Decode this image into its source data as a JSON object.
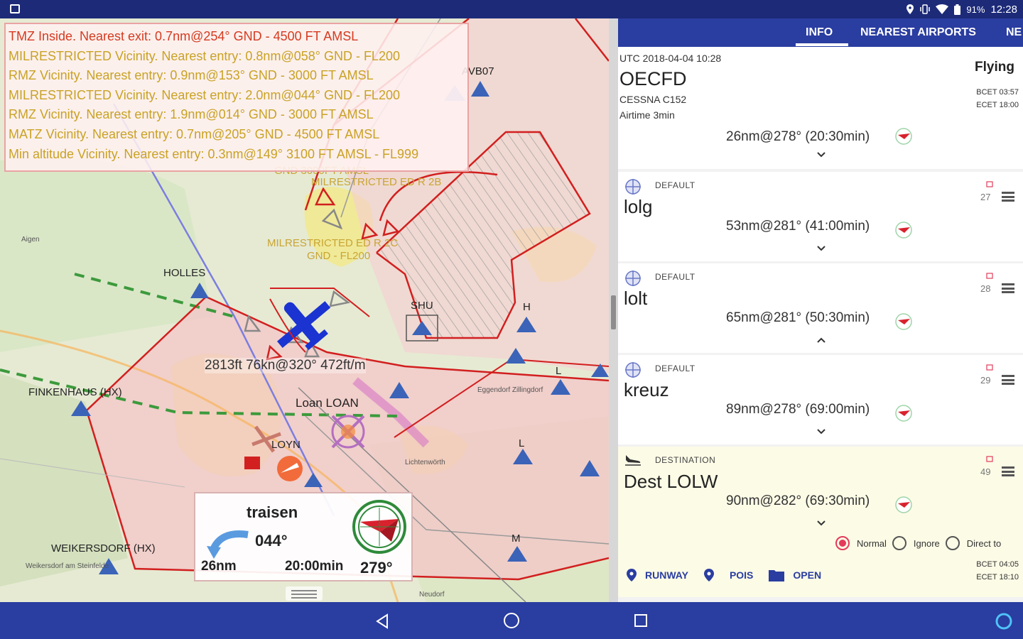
{
  "status_bar": {
    "battery": "91%",
    "time": "12:28"
  },
  "map": {
    "warnings": [
      "TMZ Inside. Nearest exit: 0.7nm@254° GND - 4500 FT AMSL",
      "MILRESTRICTED Vicinity. Nearest entry: 0.8nm@058° GND - FL200",
      "RMZ Vicinity. Nearest entry: 0.9nm@153° GND - 3000 FT AMSL",
      "MILRESTRICTED Vicinity. Nearest entry: 2.0nm@044° GND - FL200",
      "RMZ Vicinity. Nearest entry: 1.9nm@014° GND - 3000 FT AMSL",
      "MATZ Vicinity. Nearest entry: 0.7nm@205° GND - 4500 FT AMSL",
      "Min altitude Vicinity. Nearest entry: 0.3nm@149° 3100 FT AMSL - FL999"
    ],
    "labels": {
      "finkenhaus": "FINKENHAUS (HX)",
      "weikersdorf": "WEIKERSDORF (HX)",
      "weikersdorf_town": "Weikersdorf am Steinfelde",
      "holle": "HOLLES",
      "shu": "SHU",
      "avb07": "AVB07",
      "loan": "Loan LOAN",
      "loyn": "LOYN",
      "lichtenwörth": "Lichtenwörth",
      "zillingdorf": "Eggendorf Zillingdorf",
      "neudorf": "Neudorf",
      "aigen": "Aigen",
      "milrestricted": "MILRESTRICTED ED R 2C",
      "gnd": "GND - FL200",
      "gnd3000": "GND 3000FT AMSL",
      "milrestricted2": "MILRESTRICTED ED R 2B",
      "l1": "L",
      "l2": "L",
      "h": "H",
      "m": "M"
    },
    "aircraft_readout": "2813ft 76kn@320° 472ft/m",
    "nav_card": {
      "waypoint": "traisen",
      "heading": "044°",
      "distance": "26nm",
      "ete": "20:00min",
      "course": "279°"
    }
  },
  "tabs": [
    {
      "label": "INFO",
      "active": true
    },
    {
      "label": "NEAREST AIRPORTS",
      "active": false
    },
    {
      "label": "NE",
      "active": false
    }
  ],
  "info": {
    "utc": "UTC 2018-04-04 10:28",
    "registration": "OECFD",
    "aircraft_type": "CESSNA C152",
    "airtime": "Airtime 3min",
    "state": "Flying",
    "bcet": "BCET 03:57",
    "ecet": "ECET 18:00",
    "nav": "26nm@278° (20:30min)"
  },
  "waypoints": [
    {
      "tag": "DEFAULT",
      "name": "lolg",
      "nav": "53nm@281° (41:00min)",
      "number": "27"
    },
    {
      "tag": "DEFAULT",
      "name": "lolt",
      "nav": "65nm@281° (50:30min)",
      "number": "28"
    },
    {
      "tag": "DEFAULT",
      "name": "kreuz",
      "nav": "89nm@278° (69:00min)",
      "number": "29"
    }
  ],
  "destination": {
    "tag": "DESTINATION",
    "name": "Dest LOLW",
    "nav": "90nm@282° (69:30min)",
    "number": "49",
    "options": [
      "Normal",
      "Ignore",
      "Direct to"
    ],
    "selected": "Normal",
    "actions": {
      "runway": "RUNWAY",
      "pois": "POIS",
      "open": "OPEN"
    },
    "bcet": "BCET 04:05",
    "ecet": "ECET 18:10"
  },
  "colors": {
    "primary": "#2a3da0",
    "status_bar": "#1c2a78",
    "airspace_red": "#d21f1f",
    "warning_amber": "#c9a224",
    "accent": "#e33b5a"
  }
}
